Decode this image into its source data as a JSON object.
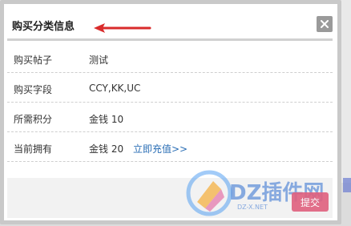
{
  "dialog": {
    "title": "购买分类信息",
    "close_icon": "close-icon",
    "annotation_color": "#d92b2b"
  },
  "rows": [
    {
      "label": "购买帖子",
      "value": "测试"
    },
    {
      "label": "购买字段",
      "value": "CCY,KK,UC"
    },
    {
      "label": "所需积分",
      "value": "金钱 10"
    },
    {
      "label": "当前拥有",
      "value": "金钱 20",
      "link": "立即充值>>"
    }
  ],
  "footer": {
    "submit_label": "提交",
    "submit_color": "#e0607e"
  },
  "watermark": {
    "text": "DZ插件网",
    "sub": "DZ-X.NET"
  }
}
